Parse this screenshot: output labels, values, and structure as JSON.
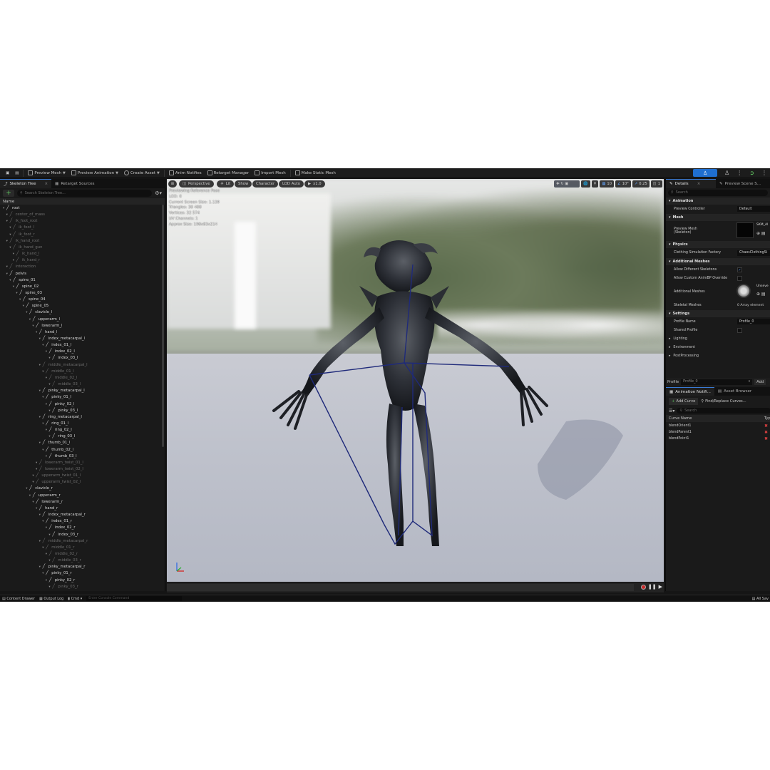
{
  "toolbar": {
    "preview_mesh": "Preview Mesh",
    "preview_animation": "Preview Animation",
    "create_asset": "Create Asset",
    "anim_notifies": "Anim Notifies",
    "retarget_manager": "Retarget Manager",
    "import_mesh": "Import Mesh",
    "make_static_mesh": "Make Static Mesh"
  },
  "left_panel": {
    "tab_skeleton_tree": "Skeleton Tree",
    "tab_retarget_sources": "Retarget Sources",
    "search_placeholder": "Search Skeleton Tree...",
    "add_label": "+",
    "column_name": "Name",
    "bones": [
      {
        "name": "root",
        "depth": 0,
        "dim": false
      },
      {
        "name": "center_of_mass",
        "depth": 1,
        "dim": true
      },
      {
        "name": "ik_foot_root",
        "depth": 1,
        "dim": true
      },
      {
        "name": "ik_foot_l",
        "depth": 2,
        "dim": true
      },
      {
        "name": "ik_foot_r",
        "depth": 2,
        "dim": true
      },
      {
        "name": "ik_hand_root",
        "depth": 1,
        "dim": true
      },
      {
        "name": "ik_hand_gun",
        "depth": 2,
        "dim": true
      },
      {
        "name": "ik_hand_l",
        "depth": 3,
        "dim": true
      },
      {
        "name": "ik_hand_r",
        "depth": 3,
        "dim": true
      },
      {
        "name": "interaction",
        "depth": 1,
        "dim": true
      },
      {
        "name": "pelvis",
        "depth": 1,
        "dim": false
      },
      {
        "name": "spine_01",
        "depth": 2,
        "dim": false
      },
      {
        "name": "spine_02",
        "depth": 3,
        "dim": false
      },
      {
        "name": "spine_03",
        "depth": 4,
        "dim": false
      },
      {
        "name": "spine_04",
        "depth": 5,
        "dim": false
      },
      {
        "name": "spine_05",
        "depth": 6,
        "dim": false
      },
      {
        "name": "clavicle_l",
        "depth": 7,
        "dim": false
      },
      {
        "name": "upperarm_l",
        "depth": 8,
        "dim": false
      },
      {
        "name": "lowerarm_l",
        "depth": 9,
        "dim": false
      },
      {
        "name": "hand_l",
        "depth": 10,
        "dim": false
      },
      {
        "name": "index_metacarpal_l",
        "depth": 11,
        "dim": false
      },
      {
        "name": "index_01_l",
        "depth": 12,
        "dim": false
      },
      {
        "name": "index_02_l",
        "depth": 13,
        "dim": false
      },
      {
        "name": "index_03_l",
        "depth": 14,
        "dim": false
      },
      {
        "name": "middle_metacarpal_l",
        "depth": 11,
        "dim": true
      },
      {
        "name": "middle_01_l",
        "depth": 12,
        "dim": true
      },
      {
        "name": "middle_02_l",
        "depth": 13,
        "dim": true
      },
      {
        "name": "middle_03_l",
        "depth": 14,
        "dim": true
      },
      {
        "name": "pinky_metacarpal_l",
        "depth": 11,
        "dim": false
      },
      {
        "name": "pinky_01_l",
        "depth": 12,
        "dim": false
      },
      {
        "name": "pinky_02_l",
        "depth": 13,
        "dim": false
      },
      {
        "name": "pinky_03_l",
        "depth": 14,
        "dim": false
      },
      {
        "name": "ring_metacarpal_l",
        "depth": 11,
        "dim": false
      },
      {
        "name": "ring_01_l",
        "depth": 12,
        "dim": false
      },
      {
        "name": "ring_02_l",
        "depth": 13,
        "dim": false
      },
      {
        "name": "ring_03_l",
        "depth": 14,
        "dim": false
      },
      {
        "name": "thumb_01_l",
        "depth": 11,
        "dim": false
      },
      {
        "name": "thumb_02_l",
        "depth": 12,
        "dim": false
      },
      {
        "name": "thumb_03_l",
        "depth": 13,
        "dim": false
      },
      {
        "name": "lowerarm_twist_01_l",
        "depth": 10,
        "dim": true
      },
      {
        "name": "lowerarm_twist_02_l",
        "depth": 10,
        "dim": true
      },
      {
        "name": "upperarm_twist_01_l",
        "depth": 9,
        "dim": true
      },
      {
        "name": "upperarm_twist_02_l",
        "depth": 9,
        "dim": true
      },
      {
        "name": "clavicle_r",
        "depth": 7,
        "dim": false
      },
      {
        "name": "upperarm_r",
        "depth": 8,
        "dim": false
      },
      {
        "name": "lowerarm_r",
        "depth": 9,
        "dim": false
      },
      {
        "name": "hand_r",
        "depth": 10,
        "dim": false
      },
      {
        "name": "index_metacarpal_r",
        "depth": 11,
        "dim": false
      },
      {
        "name": "index_01_r",
        "depth": 12,
        "dim": false
      },
      {
        "name": "index_02_r",
        "depth": 13,
        "dim": false
      },
      {
        "name": "index_03_r",
        "depth": 14,
        "dim": false
      },
      {
        "name": "middle_metacarpal_r",
        "depth": 11,
        "dim": true
      },
      {
        "name": "middle_01_r",
        "depth": 12,
        "dim": true
      },
      {
        "name": "middle_02_r",
        "depth": 13,
        "dim": true
      },
      {
        "name": "middle_03_r",
        "depth": 14,
        "dim": true
      },
      {
        "name": "pinky_metacarpal_r",
        "depth": 11,
        "dim": false
      },
      {
        "name": "pinky_01_r",
        "depth": 12,
        "dim": false
      },
      {
        "name": "pinky_02_r",
        "depth": 13,
        "dim": false
      },
      {
        "name": "pinky_03_r",
        "depth": 14,
        "dim": true
      }
    ]
  },
  "viewport": {
    "perspective": "Perspective",
    "lit": "Lit",
    "show": "Show",
    "character": "Character",
    "lod": "LOD Auto",
    "speed": "x1.0",
    "info": [
      "Previewing Reference Pose",
      "LOD: 0",
      "Current Screen Size: 1.139",
      "Triangles: 38 488",
      "Vertices: 32 574",
      "UV Channels: 1",
      "Approx Size: 198x83x214"
    ],
    "grid_value": "10",
    "angle_value": "10°",
    "scale_value": "0.25",
    "camera_value": "1"
  },
  "right_panel": {
    "tab_details": "Details",
    "tab_preview_scene": "Preview Scene S...",
    "search_placeholder": "Search",
    "sections": {
      "animation": "Animation",
      "mesh": "Mesh",
      "physics": "Physics",
      "additional_meshes": "Additional Meshes",
      "settings": "Settings",
      "lighting": "Lighting",
      "environment": "Environment",
      "post_processing": "PostProcessing"
    },
    "props": {
      "preview_controller": "Preview Controller",
      "preview_controller_val": "Default",
      "preview_mesh": "Preview Mesh",
      "preview_mesh_sub": "(Skeleton)",
      "preview_mesh_val": "SKM_Al",
      "clothing_factory": "Clothing Simulation Factory",
      "clothing_factory_val": "ChaosClothingSi",
      "allow_diff_skeletons": "Allow Different Skeletons",
      "allow_custom_animbp": "Allow Custom AnimBP Override",
      "additional_meshes": "Additional Meshes",
      "additional_meshes_val": "Unseve",
      "skeletal_meshes": "Skeletal Meshes",
      "skeletal_meshes_val": "0 Array element",
      "profile_name": "Profile Name",
      "profile_name_val": "Profile_0",
      "shared_profile": "Shared Profile"
    },
    "profile_label": "Profile",
    "profile_val": "Profile_0",
    "add_label": "Add",
    "tab_anim_notifies": "Animation Notifi...",
    "tab_asset_browser": "Asset Browser",
    "add_curve": "Add Curve",
    "find_replace": "Find/Replace Curves...",
    "curve_search_placeholder": "Search",
    "col_curve_name": "Curve Name",
    "col_type": "Typ",
    "curves": [
      "blendOrient1",
      "blendParent1",
      "blendPoint1"
    ]
  },
  "statusbar": {
    "content_drawer": "Content Drawer",
    "output_log": "Output Log",
    "cmd": "Cmd",
    "cmd_placeholder": "Enter Console Command",
    "all_saved": "All Sav"
  }
}
